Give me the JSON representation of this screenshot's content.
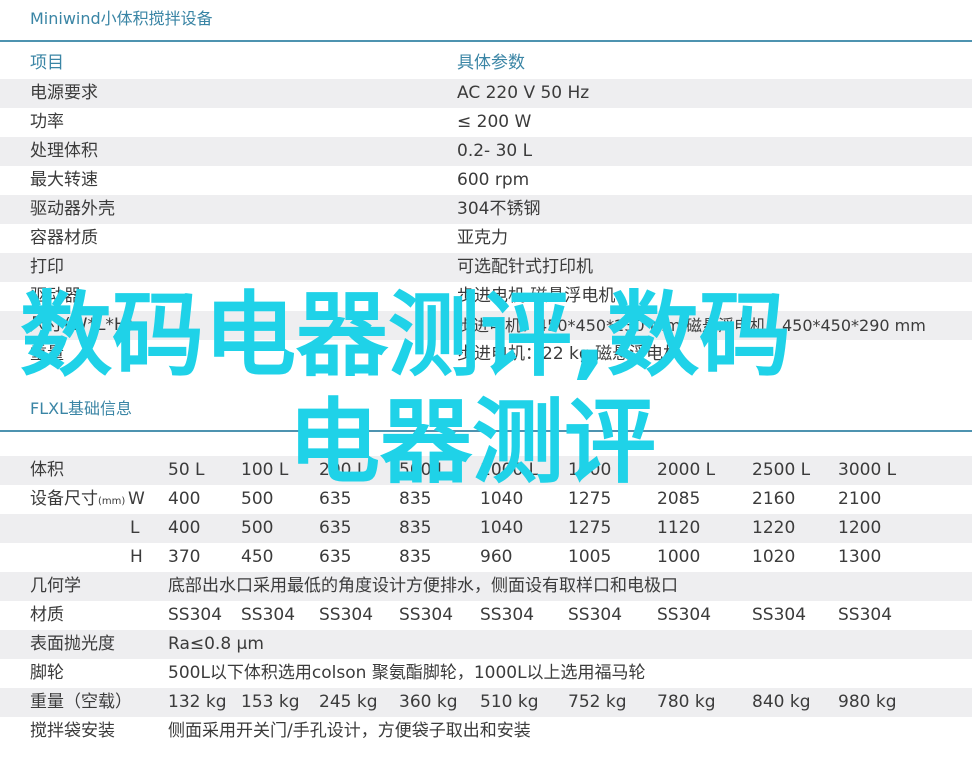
{
  "mini": {
    "title": "Miniwind小体积搅拌设备",
    "header": {
      "item": "项目",
      "param": "具体参数"
    },
    "rows": [
      {
        "label": "电源要求",
        "value": "AC 220 V 50 Hz"
      },
      {
        "label": "功率",
        "value": "≤ 200 W"
      },
      {
        "label": "处理体积",
        "value": "0.2- 30 L"
      },
      {
        "label": "最大转速",
        "value": "600 rpm"
      },
      {
        "label": "驱动器外壳",
        "value": "304不锈钢"
      },
      {
        "label": "容器材质",
        "value": "亚克力"
      },
      {
        "label": "打印",
        "value": "可选配针式打印机"
      },
      {
        "label": "驱动器",
        "value": "步进电机 磁悬浮电机"
      },
      {
        "label": "尺寸(W*L*H)",
        "value": "步进电机：450*450*230 mm 磁悬浮电机：450*450*290 mm"
      },
      {
        "label": "重量",
        "value": "步进电机：22 kg 磁悬浮电机"
      }
    ]
  },
  "flxl": {
    "title": "FLXL基础信息",
    "volume_label": "体积",
    "volumes": [
      "50 L",
      "100 L",
      "200 L",
      "500 L",
      "1000 L",
      "1500 L",
      "2000 L",
      "2500 L",
      "3000 L"
    ],
    "size_label": "设备尺寸",
    "size_unit": "(mm)",
    "dims": [
      {
        "axis": "W",
        "values": [
          "400",
          "500",
          "635",
          "835",
          "1040",
          "1275",
          "2085",
          "2160",
          "2100"
        ]
      },
      {
        "axis": "L",
        "values": [
          "400",
          "500",
          "635",
          "835",
          "1040",
          "1275",
          "1120",
          "1220",
          "1200"
        ]
      },
      {
        "axis": "H",
        "values": [
          "370",
          "450",
          "635",
          "835",
          "960",
          "1005",
          "1000",
          "1020",
          "1300"
        ]
      }
    ],
    "geometry_label": "几何学",
    "geometry_value": "底部出水口采用最低的角度设计方便排水，侧面设有取样口和电极口",
    "material_label": "材质",
    "materials": [
      "SS304",
      "SS304",
      "SS304",
      "SS304",
      "SS304",
      "SS304",
      "SS304",
      "SS304",
      "SS304"
    ],
    "polish_label": "表面抛光度",
    "polish_value": "Ra≤0.8 μm",
    "wheels_label": "脚轮",
    "wheels_value": "500L以下体积选用colson 聚氨酯脚轮，1000L以上选用福马轮",
    "weight_label": "重量（空载）",
    "weights": [
      "132 kg",
      "153 kg",
      "245 kg",
      "360 kg",
      "510 kg",
      "752 kg",
      "780 kg",
      "840 kg",
      "980 kg"
    ],
    "bag_label": "搅拌袋安装",
    "bag_value": "侧面采用开关门/手孔设计，方便袋子取出和安装"
  },
  "watermark": {
    "line1": "数码电器测评,数码",
    "line2": "电器测评"
  },
  "colors": {
    "accent": "#3a85a5",
    "rule": "#4e93b0",
    "stripe": "#eeeef0",
    "watermark": "#1fd2e8"
  }
}
